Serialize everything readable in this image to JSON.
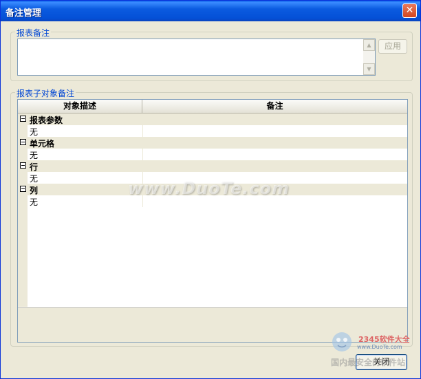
{
  "window": {
    "title": "备注管理",
    "close_glyph": "✕"
  },
  "report_note": {
    "legend": "报表备注",
    "text_value": "",
    "apply_label": "应用"
  },
  "sub_note": {
    "legend": "报表子对象备注",
    "columns": [
      "对象描述",
      "备注"
    ],
    "groups": [
      {
        "label": "报表参数",
        "children": [
          {
            "label": "无",
            "note": ""
          }
        ]
      },
      {
        "label": "单元格",
        "children": [
          {
            "label": "无",
            "note": ""
          }
        ]
      },
      {
        "label": "行",
        "children": [
          {
            "label": "无",
            "note": ""
          }
        ]
      },
      {
        "label": "列",
        "children": [
          {
            "label": "无",
            "note": ""
          }
        ]
      }
    ]
  },
  "footer": {
    "close_label": "关闭"
  },
  "watermark": {
    "main": "www.DuoTe.com",
    "logo": "2345软件大全",
    "logo_url": "www.DuoTe.com",
    "bottom": "国内最安全的软件站"
  }
}
